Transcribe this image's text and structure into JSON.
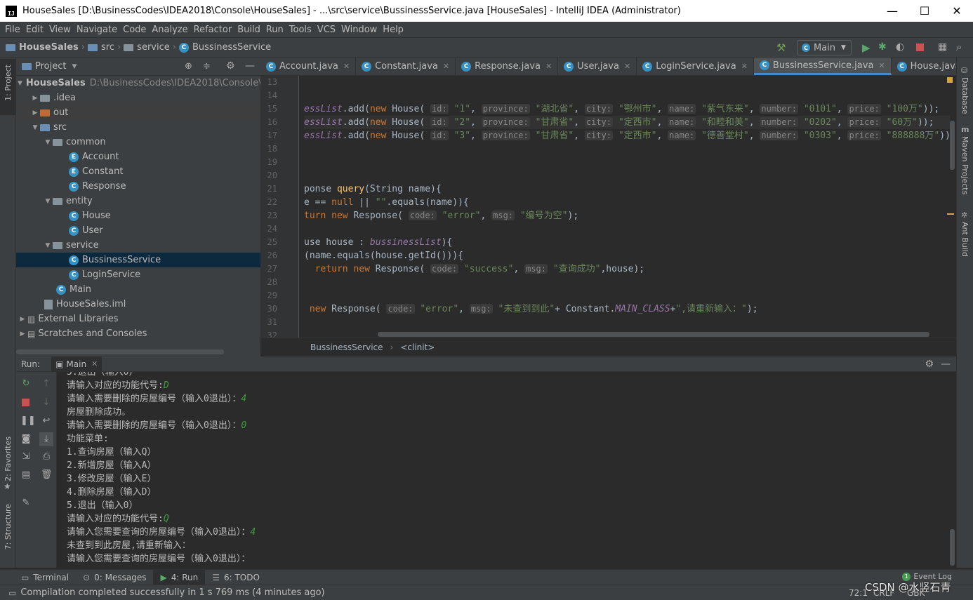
{
  "window": {
    "title": "HouseSales [D:\\BusinessCodes\\IDEA2018\\Console\\HouseSales] - ...\\src\\service\\BussinessService.java [HouseSales] - IntelliJ IDEA (Administrator)",
    "minimize": "—",
    "maximize": "☐",
    "close": "✕"
  },
  "menu": [
    "File",
    "Edit",
    "View",
    "Navigate",
    "Code",
    "Analyze",
    "Refactor",
    "Build",
    "Run",
    "Tools",
    "VCS",
    "Window",
    "Help"
  ],
  "breadcrumb": {
    "project": "HouseSales",
    "src": "src",
    "service": "service",
    "file": "BussinessService"
  },
  "run_config": "Main",
  "project_panel": {
    "title": "Project",
    "root_name": "HouseSales",
    "root_path": "D:\\BusinessCodes\\IDEA2018\\Console\\H",
    "items": [
      {
        "label": ".idea"
      },
      {
        "label": "out"
      },
      {
        "label": "src"
      },
      {
        "label": "common"
      },
      {
        "label": "Account"
      },
      {
        "label": "Constant"
      },
      {
        "label": "Response"
      },
      {
        "label": "entity"
      },
      {
        "label": "House"
      },
      {
        "label": "User"
      },
      {
        "label": "service"
      },
      {
        "label": "BussinessService"
      },
      {
        "label": "LoginService"
      },
      {
        "label": "Main"
      },
      {
        "label": "HouseSales.iml"
      },
      {
        "label": "External Libraries"
      },
      {
        "label": "Scratches and Consoles"
      }
    ]
  },
  "tabs": [
    "Account.java",
    "Constant.java",
    "Response.java",
    "User.java",
    "LoginService.java",
    "BussinessService.java",
    "House.java"
  ],
  "editor": {
    "line_numbers": [
      "13",
      "14",
      "15",
      "16",
      "17",
      "18",
      "19",
      "20",
      "21",
      "22",
      "23",
      "24",
      "25",
      "26",
      "27",
      "28",
      "29",
      "30",
      "31",
      "32"
    ],
    "breadcrumb_class": "BussinessService",
    "breadcrumb_member": "<clinit>"
  },
  "left_tools": {
    "project": "1: Project",
    "favorites": "2: Favorites",
    "structure": "7: Structure"
  },
  "right_tools": {
    "database": "Database",
    "maven": "Maven Projects",
    "ant": "Ant Build"
  },
  "run": {
    "label": "Run:",
    "tab": "Main",
    "console": [
      "5.退出（输入0）",
      "请输入对应的功能代号:|D",
      "请输入需要删除的房屋编号（输入0退出）：|4",
      "房屋删除成功。",
      "请输入需要删除的房屋编号（输入0退出）：|0",
      "功能菜单:",
      "1.查询房屋（输入Q）",
      "2.新增房屋（输入A）",
      "3.修改房屋（输入E）",
      "4.删除房屋（输入D）",
      "5.退出（输入0）",
      "请输入对应的功能代号:|Q",
      "请输入您需要查询的房屋编号（输入0退出）：|4",
      "未查到到此房屋,请重新输入：",
      "请输入您需要查询的房屋编号（输入0退出）："
    ]
  },
  "bottom_tabs": [
    {
      "label": "Terminal"
    },
    {
      "label": "0: Messages"
    },
    {
      "label": "4: Run"
    },
    {
      "label": "6: TODO"
    }
  ],
  "event_log": "Event Log",
  "status": {
    "message": "Compilation completed successfully in 1 s 769 ms (4 minutes ago)",
    "position": "72:1",
    "line_sep": "CRLF",
    "encoding": "GBK",
    "watermark": "CSDN @水竖石青"
  }
}
